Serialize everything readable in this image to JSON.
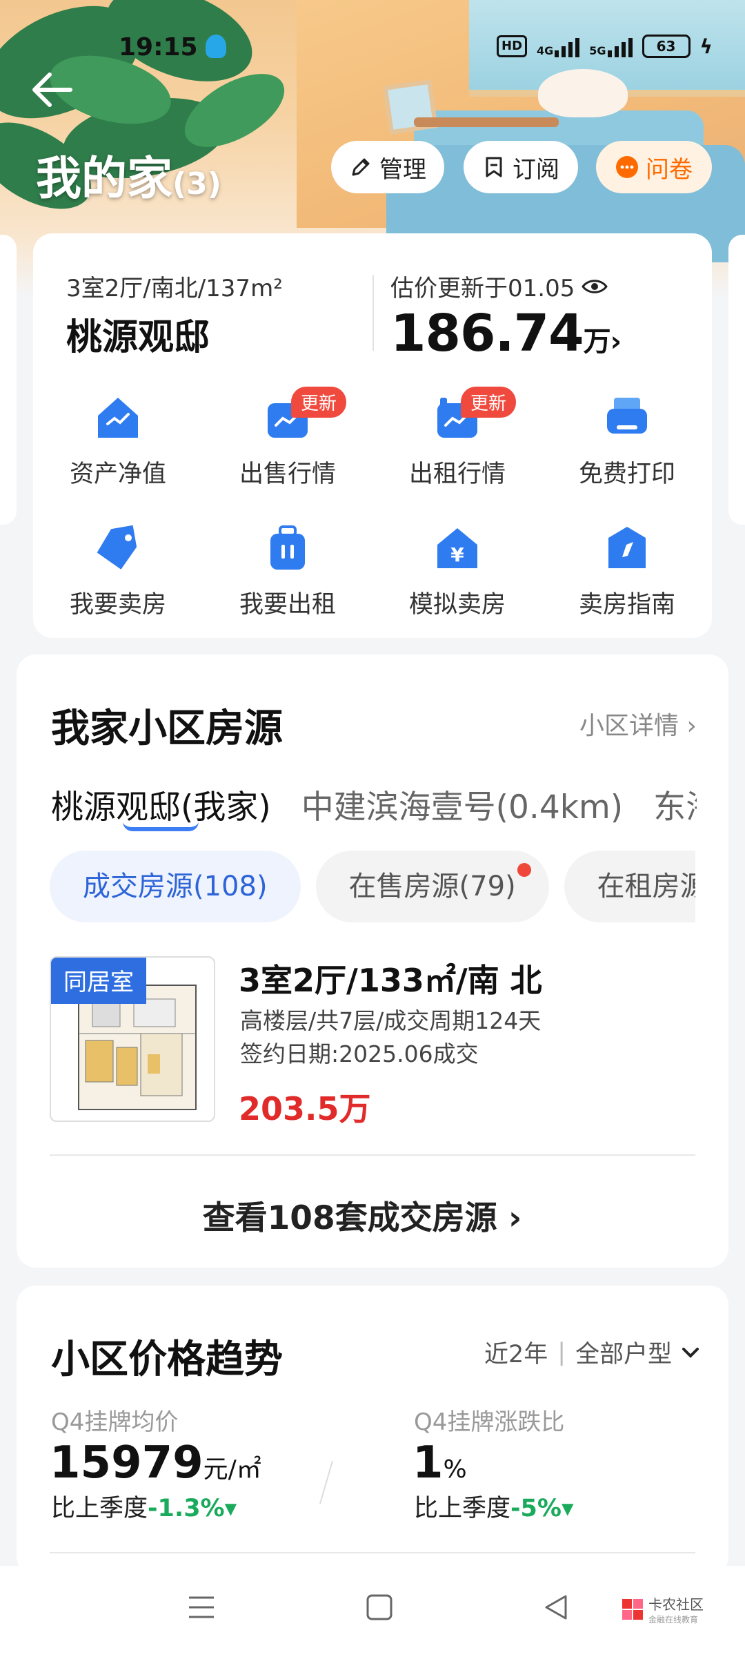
{
  "status_bar": {
    "time": "19:15",
    "hd": "HD",
    "net1": "4G",
    "net2": "5G",
    "battery": "63"
  },
  "header": {
    "title": "我的家",
    "count": "(3)",
    "manage": "管理",
    "subscribe": "订阅",
    "survey": "问卷"
  },
  "home": {
    "specs": "3室2厅/南北/137m²",
    "name": "桃源观邸",
    "estimate_label": "估价更新于01.05",
    "price_value": "186.74",
    "price_unit": "万",
    "price_arrow": "›"
  },
  "tools": [
    {
      "label": "资产净值",
      "icon": "house-chart-icon"
    },
    {
      "label": "出售行情",
      "icon": "trend-chart-icon",
      "badge": "更新"
    },
    {
      "label": "出租行情",
      "icon": "rent-chart-icon",
      "badge": "更新"
    },
    {
      "label": "免费打印",
      "icon": "printer-icon"
    },
    {
      "label": "我要卖房",
      "icon": "price-tag-icon"
    },
    {
      "label": "我要出租",
      "icon": "suitcase-icon"
    },
    {
      "label": "模拟卖房",
      "icon": "yuan-house-icon"
    },
    {
      "label": "卖房指南",
      "icon": "compass-icon"
    }
  ],
  "listings": {
    "title": "我家小区房源",
    "detail_link": "小区详情 ›",
    "tabs": [
      "桃源观邸(我家)",
      "中建滨海壹号(0.4km)",
      "东海"
    ],
    "chips": [
      "成交房源(108)",
      "在售房源(79)",
      "在租房源"
    ],
    "item": {
      "tag": "同居室",
      "title": "3室2厅/133㎡/南 北",
      "line1": "高楼层/共7层/成交周期124天",
      "line2": "签约日期:2025.06成交",
      "price": "203.5万"
    },
    "view_all": "查看108套成交房源 ›"
  },
  "trend": {
    "title": "小区价格趋势",
    "filter_period": "近2年",
    "filter_sep": "|",
    "filter_type": "全部户型",
    "avg_label": "Q4挂牌均价",
    "avg_value": "15979",
    "avg_unit": "元/㎡",
    "avg_cmp_label": "比上季度",
    "avg_cmp_value": "-1.3%▾",
    "ratio_label": "Q4挂牌涨跌比",
    "ratio_value": "1",
    "ratio_unit": "%",
    "ratio_cmp_label": "比上季度",
    "ratio_cmp_value": "-5%▾"
  },
  "watermark": {
    "name": "卡农社区",
    "sub": "金融在线教育"
  },
  "colors": {
    "accent": "#2d64d8",
    "badge": "#f04a3e",
    "price_red": "#e12b2b",
    "down_green": "#1aaa5c",
    "survey": "#ff6a00"
  }
}
